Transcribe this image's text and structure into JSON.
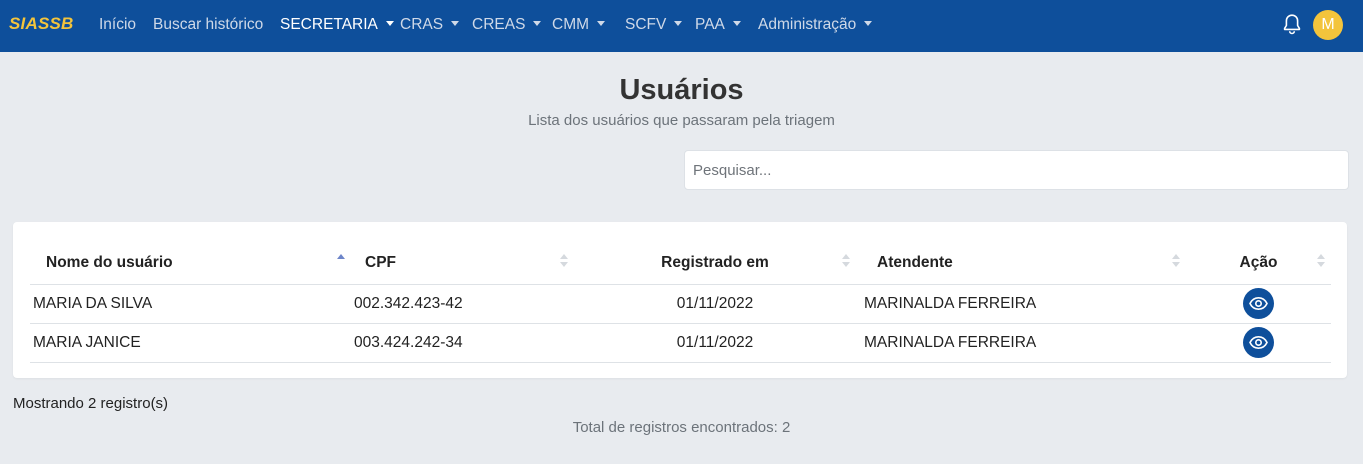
{
  "navbar": {
    "brand": "SIASSB",
    "items": [
      {
        "label": "Início"
      },
      {
        "label": "Buscar histórico"
      },
      {
        "label": "SECRETARIA"
      },
      {
        "label": "CRAS"
      },
      {
        "label": "CREAS"
      },
      {
        "label": "CMM"
      },
      {
        "label": "SCFV"
      },
      {
        "label": "PAA"
      },
      {
        "label": "Administração"
      }
    ],
    "avatar_initial": "M",
    "notification_icon": "bell-icon"
  },
  "header": {
    "title": "Usuários",
    "subtitle": "Lista dos usuários que passaram pela triagem"
  },
  "search": {
    "placeholder": "Pesquisar...",
    "value": ""
  },
  "table": {
    "columns": [
      {
        "label": "Nome do usuário",
        "sort": "ascending"
      },
      {
        "label": "CPF",
        "sort": "none"
      },
      {
        "label": "Registrado em",
        "sort": "none"
      },
      {
        "label": "Atendente",
        "sort": "none"
      },
      {
        "label": "Ação",
        "sort": "none"
      }
    ],
    "rows": [
      {
        "nome": "MARIA DA SILVA",
        "cpf": "002.342.423-42",
        "registrado": "01/11/2022",
        "atendente": "MARINALDA FERREIRA",
        "acao_icon": "eye-icon"
      },
      {
        "nome": "MARIA JANICE",
        "cpf": "003.424.242-34",
        "registrado": "01/11/2022",
        "atendente": "MARINALDA FERREIRA",
        "acao_icon": "eye-icon"
      }
    ]
  },
  "footer": {
    "count_text": "Mostrando 2 registro(s)",
    "total_text": "Total de registros encontrados: 2"
  },
  "colors": {
    "navbar": "#0e4f9b",
    "brand": "#f3c43c",
    "background": "#e8ebef",
    "action_button": "#0e4f9b"
  }
}
